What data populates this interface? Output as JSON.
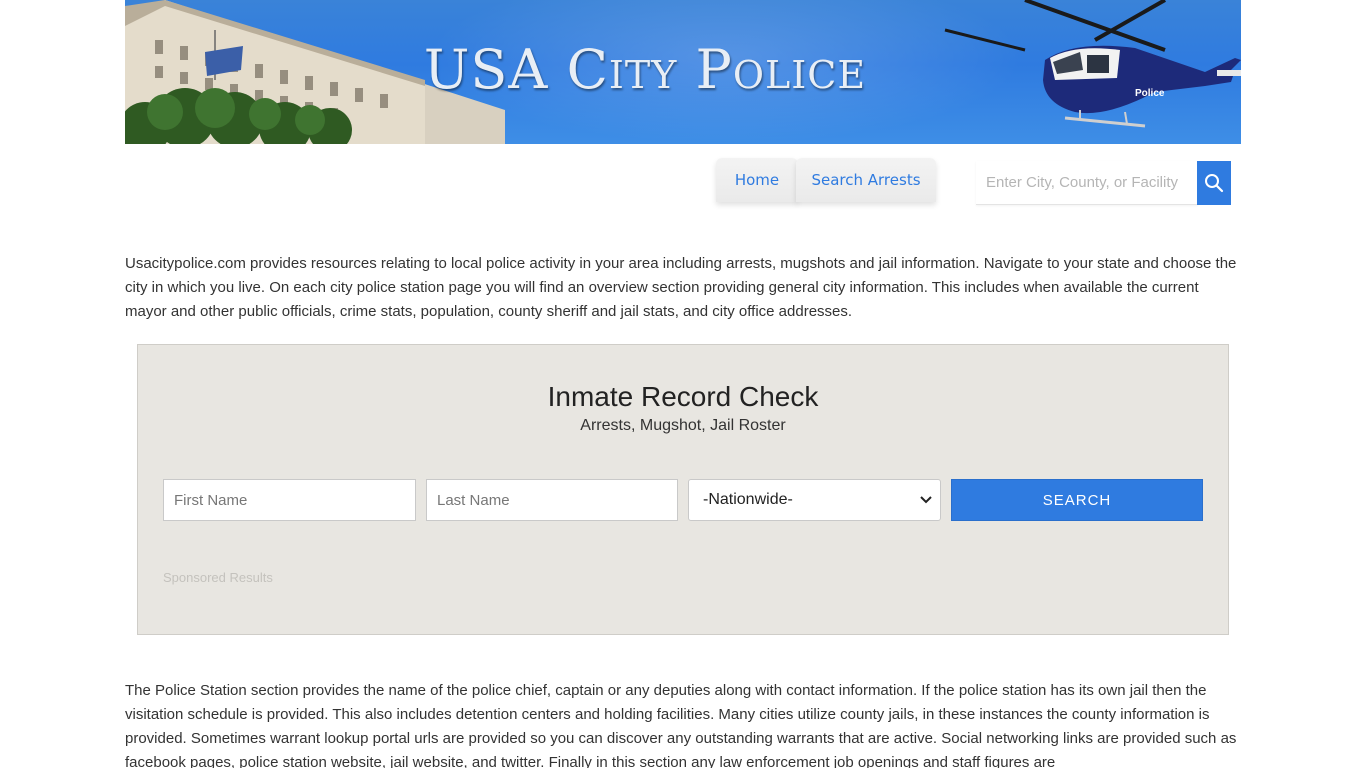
{
  "banner": {
    "title": "USA City Police",
    "helicopter_label": "Police"
  },
  "nav": {
    "items": [
      {
        "label": "Home"
      },
      {
        "label": "Search Arrests"
      }
    ]
  },
  "search": {
    "placeholder": "Enter City, County, or Facility"
  },
  "intro": {
    "text": "Usacitypolice.com provides resources relating to local police activity in your area including arrests, mugshots and jail information. Navigate to your state and choose the city in which you live. On each city police station page you will find an overview section providing general city information. This includes when available the current mayor and other public officials, crime stats, population, county sheriff and jail stats, and city office addresses."
  },
  "inmate": {
    "title": "Inmate Record Check",
    "subtitle": "Arrests, Mugshot, Jail Roster",
    "first_name_placeholder": "First Name",
    "last_name_placeholder": "Last Name",
    "state_selected": "-Nationwide-",
    "search_label": "Search",
    "sponsored": "Sponsored Results"
  },
  "police_section": {
    "text": "The Police Station section provides the name of the police chief, captain or any deputies along with contact information. If the police station has its own jail then the visitation schedule is provided. This also includes detention centers and holding facilities. Many cities utilize county jails, in these instances the county information is provided. Sometimes warrant lookup portal urls are provided so you can discover any outstanding warrants that are active. Social networking links are provided such as facebook pages, police station website, jail website, and twitter. Finally in this section any law enforcement job openings and staff figures are"
  },
  "colors": {
    "accent": "#2f7be0",
    "panel": "#e8e6e1"
  }
}
